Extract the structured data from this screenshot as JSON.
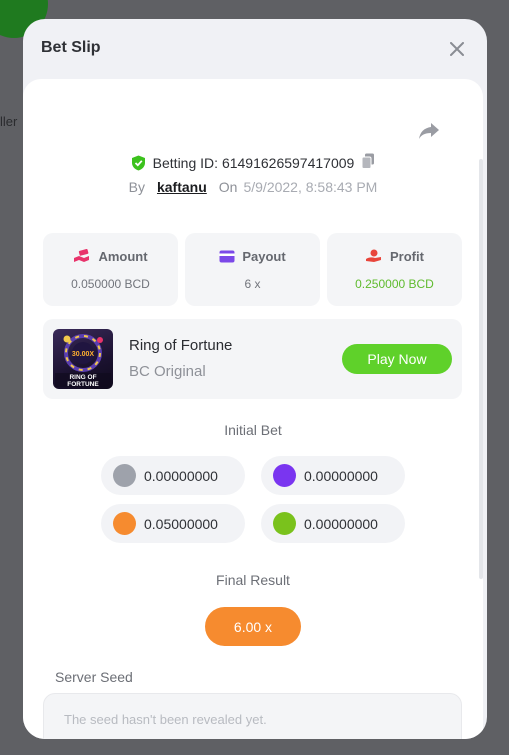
{
  "background": {
    "partial_text": "ller"
  },
  "modal": {
    "title": "Bet Slip",
    "betting_id_label": "Betting ID:",
    "betting_id": "61491626597417009",
    "by_label": "By",
    "username": "kaftanu",
    "on_label": "On",
    "date": "5/9/2022, 8:58:43 PM"
  },
  "stats": [
    {
      "label": "Amount",
      "value": "0.050000 BCD",
      "icon": "money-hand-icon"
    },
    {
      "label": "Payout",
      "value": "6 x",
      "icon": "credit-card-icon"
    },
    {
      "label": "Profit",
      "value": "0.250000 BCD",
      "icon": "profit-hand-icon"
    }
  ],
  "game": {
    "name": "Ring of Fortune",
    "subtitle": "BC Original",
    "play_label": "Play Now",
    "thumb_text": "RING OF FORTUNE",
    "thumb_value": "30.00X"
  },
  "initial_bet": {
    "title": "Initial Bet",
    "coins": [
      {
        "value": "0.00000000",
        "color": "#9ea2ab"
      },
      {
        "value": "0.00000000",
        "color": "#7a35f0"
      },
      {
        "value": "0.05000000",
        "color": "#f68b2f"
      },
      {
        "value": "0.00000000",
        "color": "#7ac21c"
      }
    ]
  },
  "final_result": {
    "title": "Final Result",
    "value": "6.00 x"
  },
  "server_seed": {
    "label": "Server Seed",
    "placeholder": "The seed hasn't been revealed yet."
  },
  "colors": {
    "accent_green": "#5fd12a",
    "profit_green": "#5fbb2e",
    "result_orange": "#f68b2f"
  }
}
